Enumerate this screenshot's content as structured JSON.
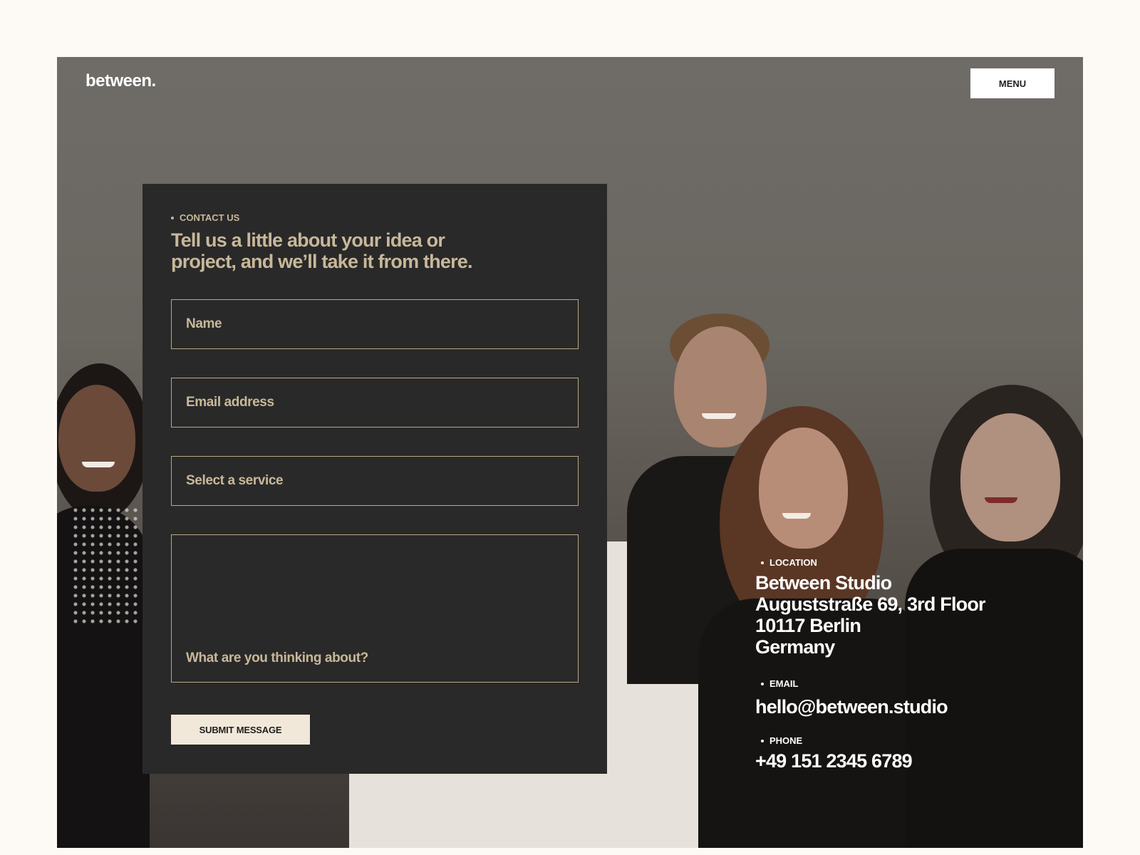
{
  "header": {
    "logo": "between.",
    "menu_label": "MENU"
  },
  "contact_form": {
    "eyebrow": "CONTACT US",
    "headline": "Tell us a little about your idea or project, and we’ll take it from there.",
    "fields": {
      "name": "Name",
      "email": "Email address",
      "service": "Select a service",
      "message": "What are you thinking about?"
    },
    "submit_label": "SUBMIT MESSAGE"
  },
  "contact_info": {
    "location": {
      "label": "LOCATION",
      "lines": [
        "Between Studio",
        "Auguststraße 69, 3rd Floor",
        "10117 Berlin",
        "Germany"
      ]
    },
    "email": {
      "label": "EMAIL",
      "value": "hello@between.studio"
    },
    "phone": {
      "label": "PHONE",
      "value": "+49 151 2345 6789"
    }
  },
  "colors": {
    "page_background": "#fdfaf6",
    "card_background": "#2a2929",
    "accent_tan": "#c7b89a",
    "field_border": "#b9a884",
    "submit_background": "#f1e8da"
  }
}
